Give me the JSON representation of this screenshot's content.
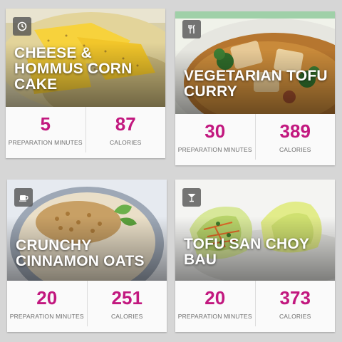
{
  "recipes": [
    {
      "title": "CHEESE & HOMMUS CORN CAKE",
      "category_icon": "clock-icon",
      "prep_minutes": "5",
      "prep_label": "PREPARATION MINUTES",
      "calories": "87",
      "calories_label": "CALORIES"
    },
    {
      "title": "VEGETARIAN TOFU CURRY",
      "category_icon": "fork-knife-icon",
      "prep_minutes": "30",
      "prep_label": "PREPARATION MINUTES",
      "calories": "389",
      "calories_label": "CALORIES"
    },
    {
      "title": "CRUNCHY CINNAMON OATS",
      "category_icon": "coffee-cup-icon",
      "prep_minutes": "20",
      "prep_label": "PREPARATION MINUTES",
      "calories": "251",
      "calories_label": "CALORIES"
    },
    {
      "title": "TOFU SAN CHOY BAU",
      "category_icon": "cocktail-glass-icon",
      "prep_minutes": "20",
      "prep_label": "PREPARATION MINUTES",
      "calories": "373",
      "calories_label": "CALORIES"
    }
  ],
  "colors": {
    "accent": "#c2187f",
    "label": "#6d6d6d",
    "background": "#d6d6d6",
    "card": "#fafafa"
  }
}
